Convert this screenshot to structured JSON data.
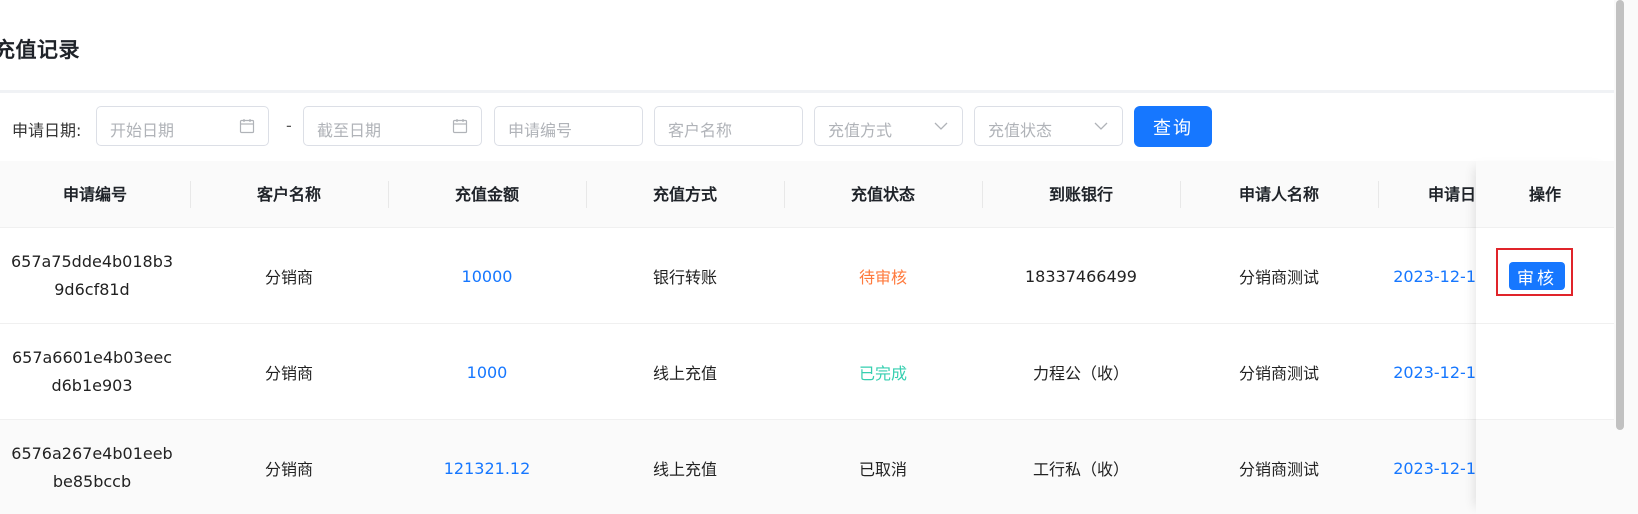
{
  "page": {
    "title": "充值记录"
  },
  "filters": {
    "date_label": "申请日期:",
    "start_date_placeholder": "开始日期",
    "separator": "-",
    "end_date_placeholder": "截至日期",
    "apply_no_placeholder": "申请编号",
    "customer_placeholder": "客户名称",
    "method_placeholder": "充值方式",
    "status_placeholder": "充值状态",
    "query_label": "查询"
  },
  "table": {
    "columns": [
      "申请编号",
      "客户名称",
      "充值金额",
      "充值方式",
      "充值状态",
      "到账银行",
      "申请人名称",
      "申请日"
    ],
    "ops_header": "操作",
    "rows": [
      {
        "apply_no_line1": "657a75dde4b018b3",
        "apply_no_line2": "9d6cf81d",
        "customer": "分销商",
        "amount": "10000",
        "method": "银行转账",
        "status": "待审核",
        "bank": "18337466499",
        "applicant": "分销商测试",
        "date": "2023-12-1",
        "action": "审核"
      },
      {
        "apply_no_line1": "657a6601e4b03eec",
        "apply_no_line2": "d6b1e903",
        "customer": "分销商",
        "amount": "1000",
        "method": "线上充值",
        "status": "已完成",
        "bank": "力程公（收）",
        "applicant": "分销商测试",
        "date": "2023-12-1"
      },
      {
        "apply_no_line1": "6576a267e4b01eeb",
        "apply_no_line2": "be85bccb",
        "customer": "分销商",
        "amount": "121321.12",
        "method": "线上充值",
        "status": "已取消",
        "bank": "工行私（收）",
        "applicant": "分销商测试",
        "date": "2023-12-1"
      }
    ]
  },
  "colors": {
    "primary": "#1677ff",
    "pending": "#ff7a3d",
    "completed": "#36cfb0",
    "highlight_frame": "#e0242a"
  },
  "icons": [
    "calendar-icon",
    "chevron-down-icon"
  ]
}
